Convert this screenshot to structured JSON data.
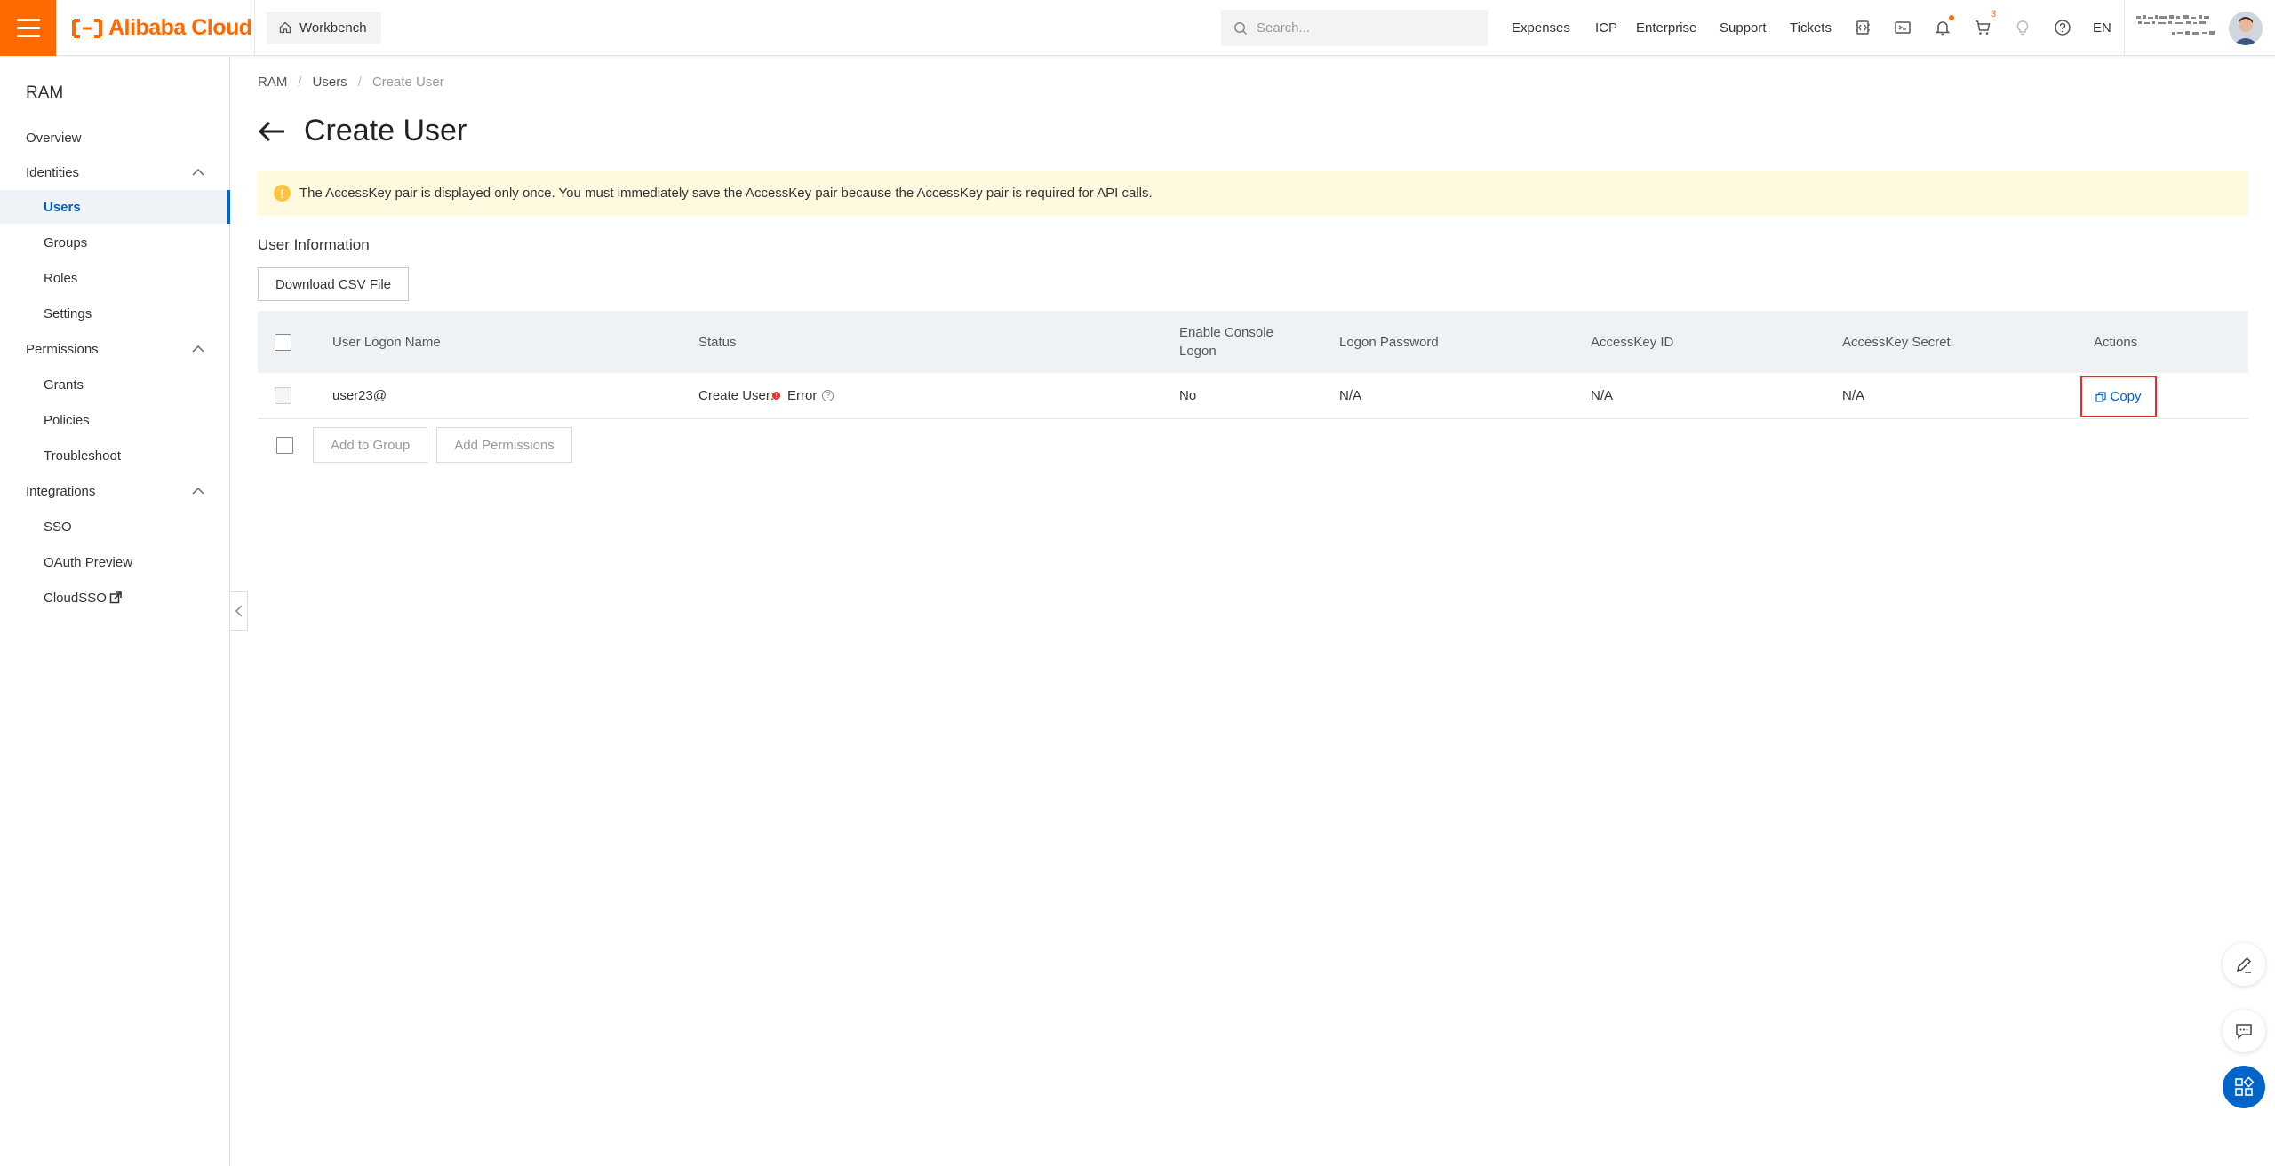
{
  "header": {
    "logo_text": "Alibaba Cloud",
    "workbench_label": "Workbench",
    "search_placeholder": "Search...",
    "nav": [
      "Expenses",
      "ICP",
      "Enterprise",
      "Support",
      "Tickets"
    ],
    "cart_count": "3",
    "language": "EN",
    "accent": "#ff6a00"
  },
  "sidebar": {
    "title": "RAM",
    "items": [
      {
        "label": "Overview"
      },
      {
        "label": "Identities"
      },
      {
        "label": "Users"
      },
      {
        "label": "Groups"
      },
      {
        "label": "Roles"
      },
      {
        "label": "Settings"
      },
      {
        "label": "Permissions"
      },
      {
        "label": "Grants"
      },
      {
        "label": "Policies"
      },
      {
        "label": "Troubleshoot"
      },
      {
        "label": "Integrations"
      },
      {
        "label": "SSO"
      },
      {
        "label": "OAuth Preview"
      },
      {
        "label": "CloudSSO"
      }
    ]
  },
  "breadcrumb": [
    "RAM",
    "Users",
    "Create User"
  ],
  "page": {
    "title": "Create User",
    "alert": "The AccessKey pair is displayed only once. You must immediately save the AccessKey pair because the AccessKey pair is required for API calls.",
    "section_label": "User Information",
    "download_label": "Download CSV File"
  },
  "table": {
    "headers": {
      "logon_name": "User Logon Name",
      "status": "Status",
      "console_line1": "Enable Console",
      "console_line2": "Logon",
      "password": "Logon Password",
      "ak_id": "AccessKey ID",
      "ak_secret": "AccessKey Secret",
      "actions": "Actions"
    },
    "rows": [
      {
        "logon_name": "user23@",
        "status_prefix": "Create User:",
        "status": "Error",
        "console": "No",
        "password": "N/A",
        "ak_id": "N/A",
        "ak_secret": "N/A",
        "action": "Copy"
      }
    ]
  },
  "bottom_actions": {
    "add_to_group": "Add to Group",
    "add_permissions": "Add Permissions"
  }
}
